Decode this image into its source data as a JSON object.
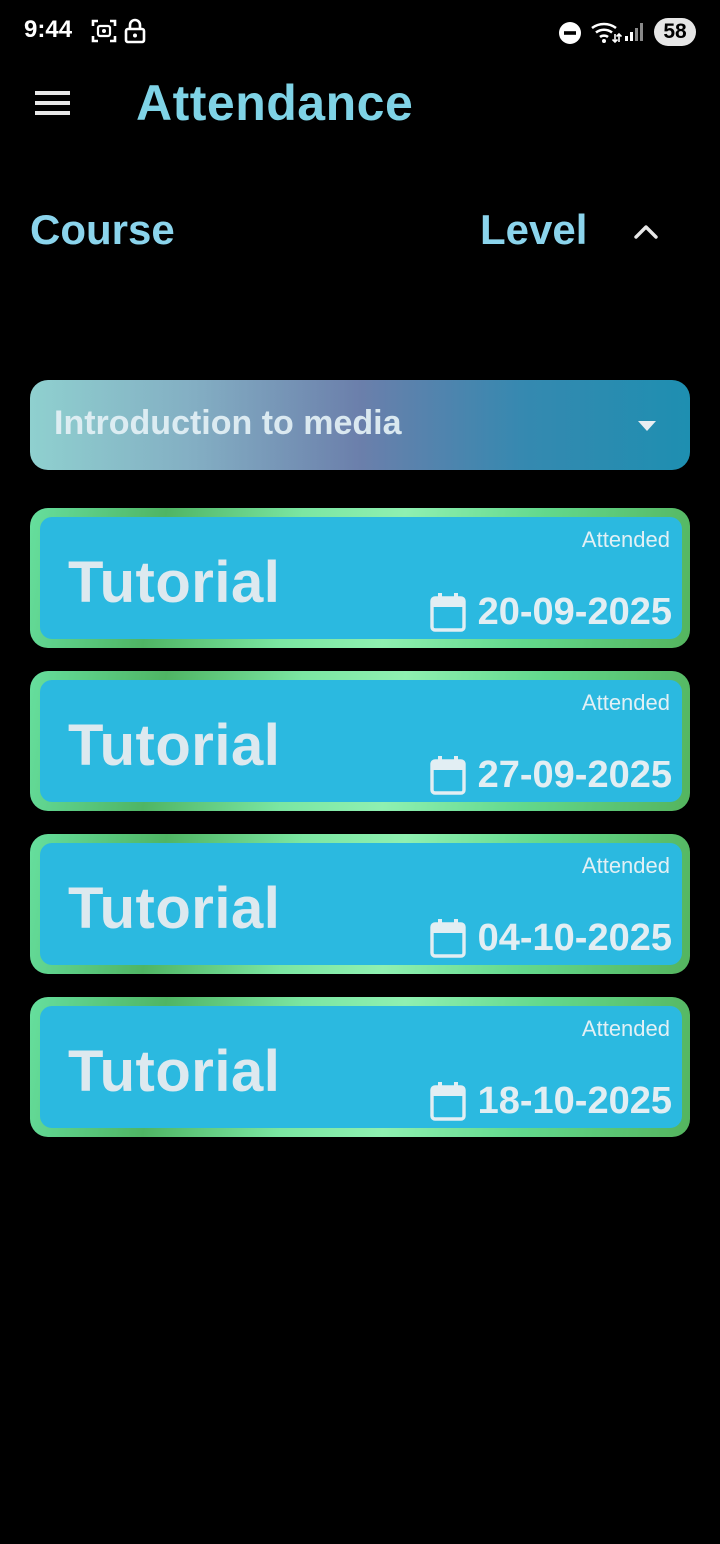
{
  "status_bar": {
    "time": "9:44",
    "battery": "58"
  },
  "app_bar": {
    "title": "Attendance"
  },
  "filters": {
    "course_label": "Course",
    "level_label": "Level",
    "selected_course": "Introduction to media"
  },
  "attendance": [
    {
      "type": "Tutorial",
      "status": "Attended",
      "date": "20-09-2025"
    },
    {
      "type": "Tutorial",
      "status": "Attended",
      "date": "27-09-2025"
    },
    {
      "type": "Tutorial",
      "status": "Attended",
      "date": "04-10-2025"
    },
    {
      "type": "Tutorial",
      "status": "Attended",
      "date": "18-10-2025"
    }
  ],
  "icons": {
    "menu": "hamburger-menu-icon",
    "collapse": "chevron-up-icon",
    "dropdown": "caret-down-icon",
    "date": "calendar-icon"
  },
  "colors": {
    "background": "#000000",
    "title": "#7fd3e6",
    "card_fill": "#2bb9e0",
    "card_border": "#66df9e"
  }
}
